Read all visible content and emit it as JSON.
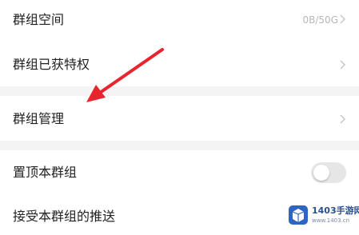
{
  "settings": {
    "space": {
      "label": "群组空间",
      "value": "0B/50G"
    },
    "privileges": {
      "label": "群组已获特权"
    },
    "manage": {
      "label": "群组管理"
    },
    "pin": {
      "label": "置顶本群组",
      "enabled": false
    },
    "push": {
      "label": "接受本群组的推送"
    }
  },
  "colors": {
    "arrow": "#e8252f",
    "divider": "#f4f4f4",
    "toggle_off": "#e6e6e6",
    "value_text": "#b7b7b7"
  },
  "watermark": {
    "text": "1403手游网",
    "sub": "www.1403.cn"
  }
}
